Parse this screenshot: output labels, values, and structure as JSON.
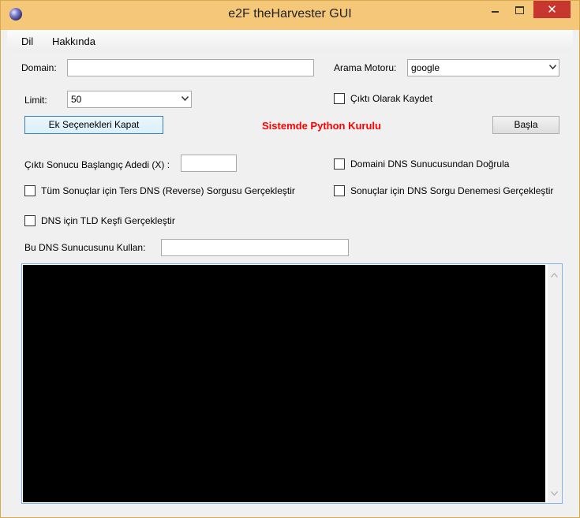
{
  "window": {
    "title": "e2F theHarvester GUI"
  },
  "menu": {
    "items": [
      "Dil",
      "Hakkında"
    ]
  },
  "form": {
    "domain_label": "Domain:",
    "domain_value": "",
    "engine_label": "Arama Motoru:",
    "engine_value": "google",
    "limit_label": "Limit:",
    "limit_value": "50",
    "save_output_label": "Çıktı Olarak Kaydet",
    "save_output_checked": false
  },
  "buttons": {
    "toggle_options": "Ek Seçenekleri Kapat",
    "start": "Başla"
  },
  "status": {
    "python_text": "Sistemde Python Kurulu",
    "color": "#ff0000"
  },
  "options": {
    "start_index_label": "Çıktı Sonucu Başlangıç Adedi (X) :",
    "start_index_value": "",
    "verify_dns_label": "Domaini DNS Sunucusundan Doğrula",
    "reverse_dns_label": "Tüm Sonuçlar için Ters DNS (Reverse) Sorgusu Gerçekleştir",
    "dns_query_label": "Sonuçlar için DNS Sorgu Denemesi Gerçekleştir",
    "tld_label": "DNS için TLD Keşfi Gerçekleştir",
    "dns_server_label": "Bu DNS Sunucusunu Kullan:",
    "dns_server_value": ""
  },
  "output": {
    "text": "",
    "background": "#000000"
  }
}
